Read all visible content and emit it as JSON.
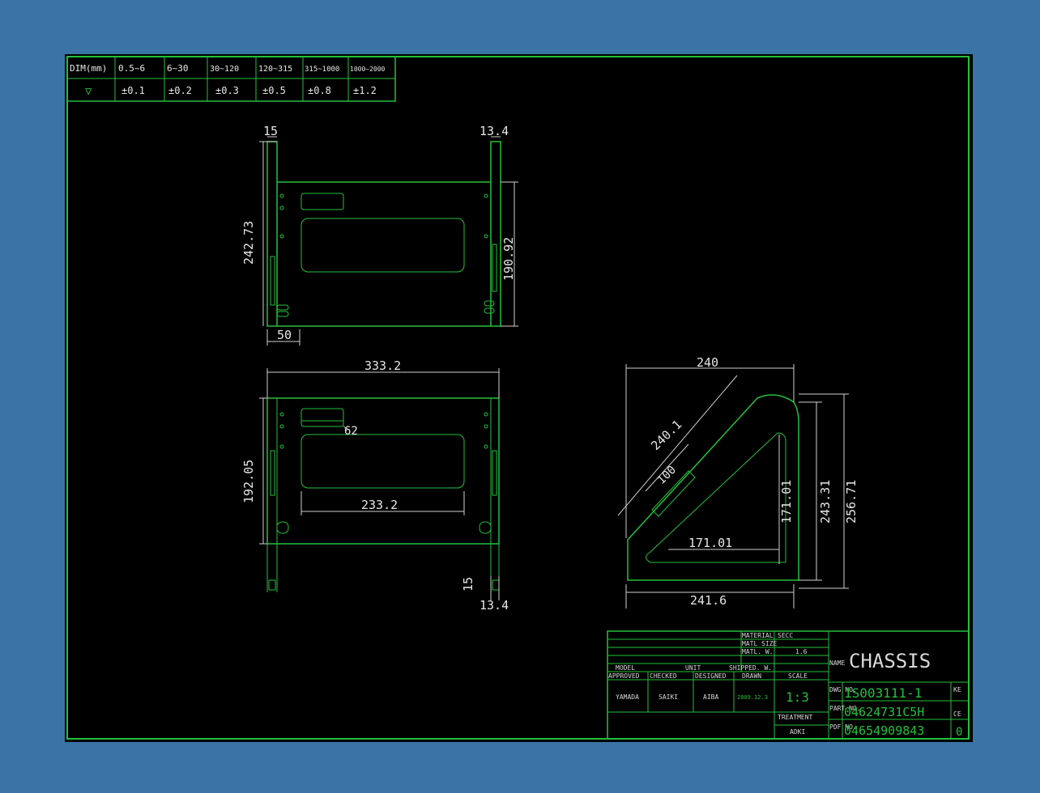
{
  "tolerance_table": {
    "header_label": "DIM(mm)",
    "ranges": [
      "0.5~6",
      "6~30",
      "30~120",
      "120~315",
      "315~1000",
      "1000~2000"
    ],
    "symbol": "▽",
    "tolerances": [
      "±0.1",
      "±0.2",
      "±0.3",
      "±0.5",
      "±0.8",
      "±1.2"
    ]
  },
  "side_view": {
    "dim_left_flange": "15",
    "dim_right_flange": "13.4",
    "dim_height": "242.73",
    "dim_inner_height": "190.92",
    "dim_depth": "50"
  },
  "front_view": {
    "dim_width": "333.2",
    "dim_height": "192.05",
    "dim_slot_width": "233.2",
    "dim_small": "62",
    "dim_bottom_left": "15",
    "dim_bottom_right": "13.4"
  },
  "triangle_view": {
    "dim_top": "240",
    "dim_diagonal": "240.1",
    "dim_slot": "100",
    "dim_inner_vertical": "171.01",
    "dim_inner_horizontal": "171.01",
    "dim_height": "243.31",
    "dim_outer_height": "256.71",
    "dim_bottom": "241.6"
  },
  "title_block": {
    "material_label": "MATERIAL",
    "material_value": "SECC",
    "matl_size_label": "MATL SIZE",
    "matl_w_label": "MATL. W.",
    "matl_w_value": "1.6",
    "model_label": "MODEL",
    "unit_label": "UNIT",
    "shipped_label": "SHIPPED. W.",
    "approved_label": "APPROVED",
    "checked_label": "CHECKED",
    "designed_label": "DESIGNED",
    "drawn_label": "DRAWN",
    "scale_label": "SCALE",
    "approved_value": "YAMADA",
    "checked_value": "SAIKI",
    "designed_value": "AIBA",
    "drawn_value": "2009.12.3",
    "scale_value": "1:3",
    "treatment_label": "TREATMENT",
    "treatment_value": "ADKI",
    "name_label": "NAME",
    "name_value": "CHASSIS",
    "dwg_no_label": "DWG NO.",
    "dwg_no_value": "1S003111-1",
    "part_no_label": "PART NO.",
    "part_no_value": "04624731C5H",
    "pdf_no_label": "PDF NO.",
    "pdf_no_value": "04654909843",
    "ke_label": "KE",
    "ce_label": "CE",
    "rev_value": "0"
  },
  "colors": {
    "background": "#3a74a6",
    "sheet": "#000000",
    "line_green": "#23c13a",
    "text_white": "#e6e6e6"
  }
}
